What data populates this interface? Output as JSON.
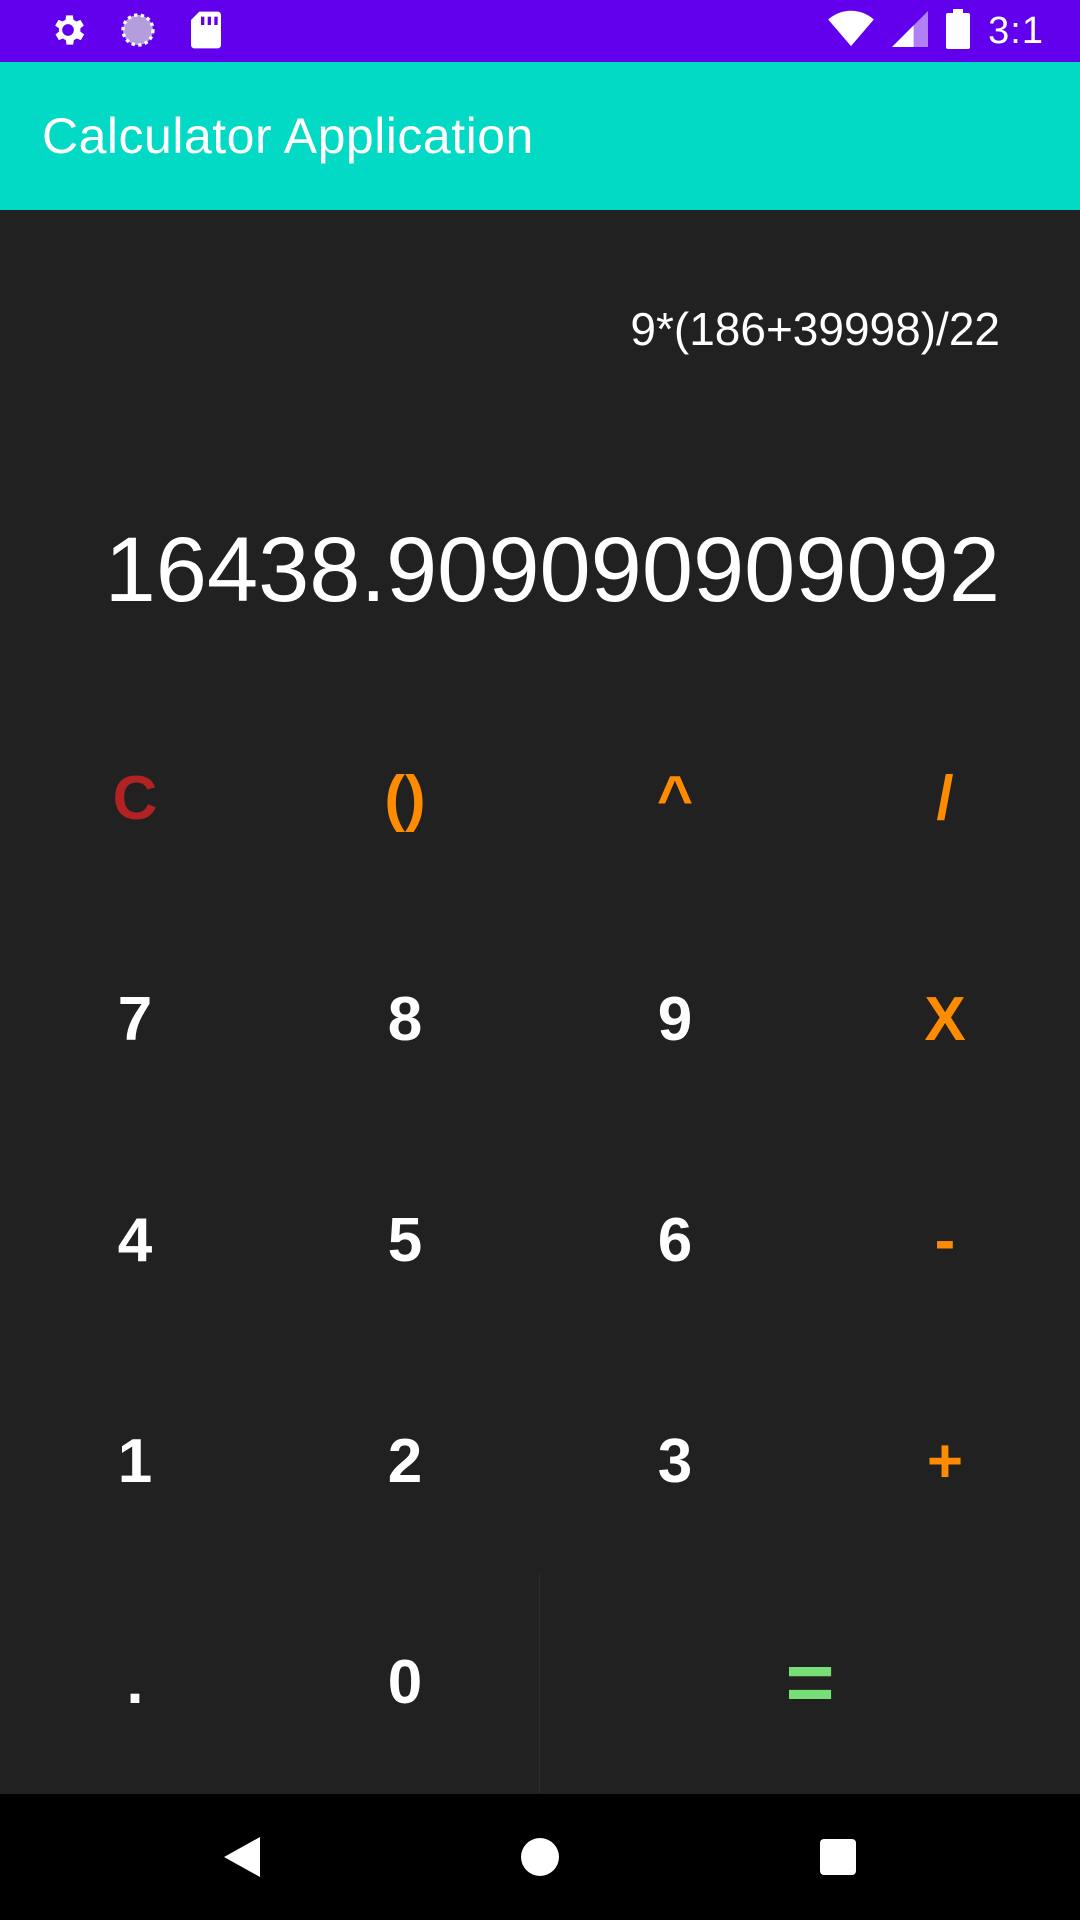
{
  "status_bar": {
    "time": "3:1",
    "left_icons": [
      "gear-icon",
      "sync-icon",
      "sd-card-icon"
    ],
    "right_icons": [
      "wifi-icon",
      "signal-icon",
      "battery-icon"
    ]
  },
  "app_bar": {
    "title": "Calculator Application"
  },
  "display": {
    "expression": "9*(186+39998)/22",
    "result": "16438.909090909092"
  },
  "keypad": {
    "rows": [
      [
        "C",
        "()",
        "^",
        "/"
      ],
      [
        "7",
        "8",
        "9",
        "X"
      ],
      [
        "4",
        "5",
        "6",
        "-"
      ],
      [
        "1",
        "2",
        "3",
        "+"
      ],
      [
        ".",
        "0",
        "="
      ]
    ]
  },
  "nav_bar": {
    "buttons": [
      "back-icon",
      "home-icon",
      "recents-icon"
    ]
  },
  "colors": {
    "status_bar": "#6200EE",
    "app_bar": "#03DAC5",
    "background": "#212121",
    "operator": "#FF8C00",
    "clear": "#B22222",
    "equals": "#77DD77"
  }
}
